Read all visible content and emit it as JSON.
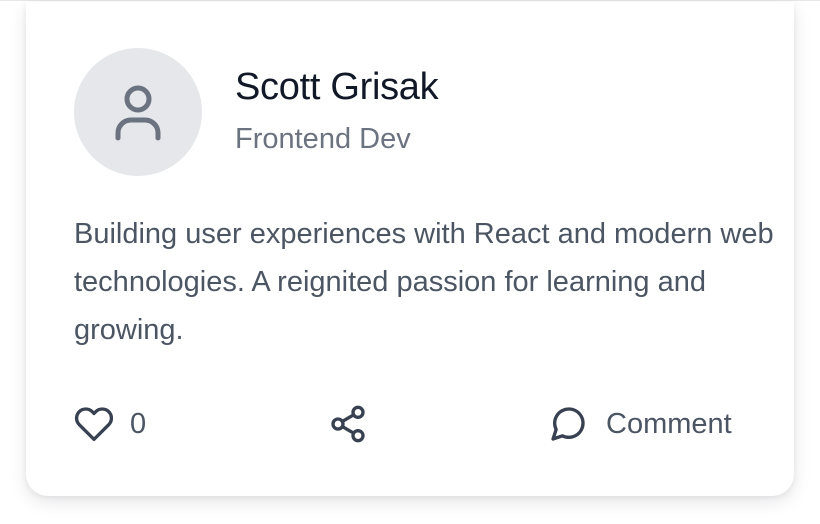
{
  "profile": {
    "name": "Scott Grisak",
    "role": "Frontend Dev",
    "avatar_icon": "user-icon",
    "bio": "Building user experiences with React and modern web technologies. A reignited passion for learning and growing."
  },
  "actions": {
    "like_icon": "heart-icon",
    "like_count": "0",
    "share_icon": "share-icon",
    "comment_icon": "message-circle-icon",
    "comment_label": "Comment"
  },
  "colors": {
    "text_primary": "#111827",
    "text_secondary": "#6b7280",
    "text_body": "#4b5563",
    "avatar_bg": "#e5e7eb",
    "icon": "#374151"
  }
}
